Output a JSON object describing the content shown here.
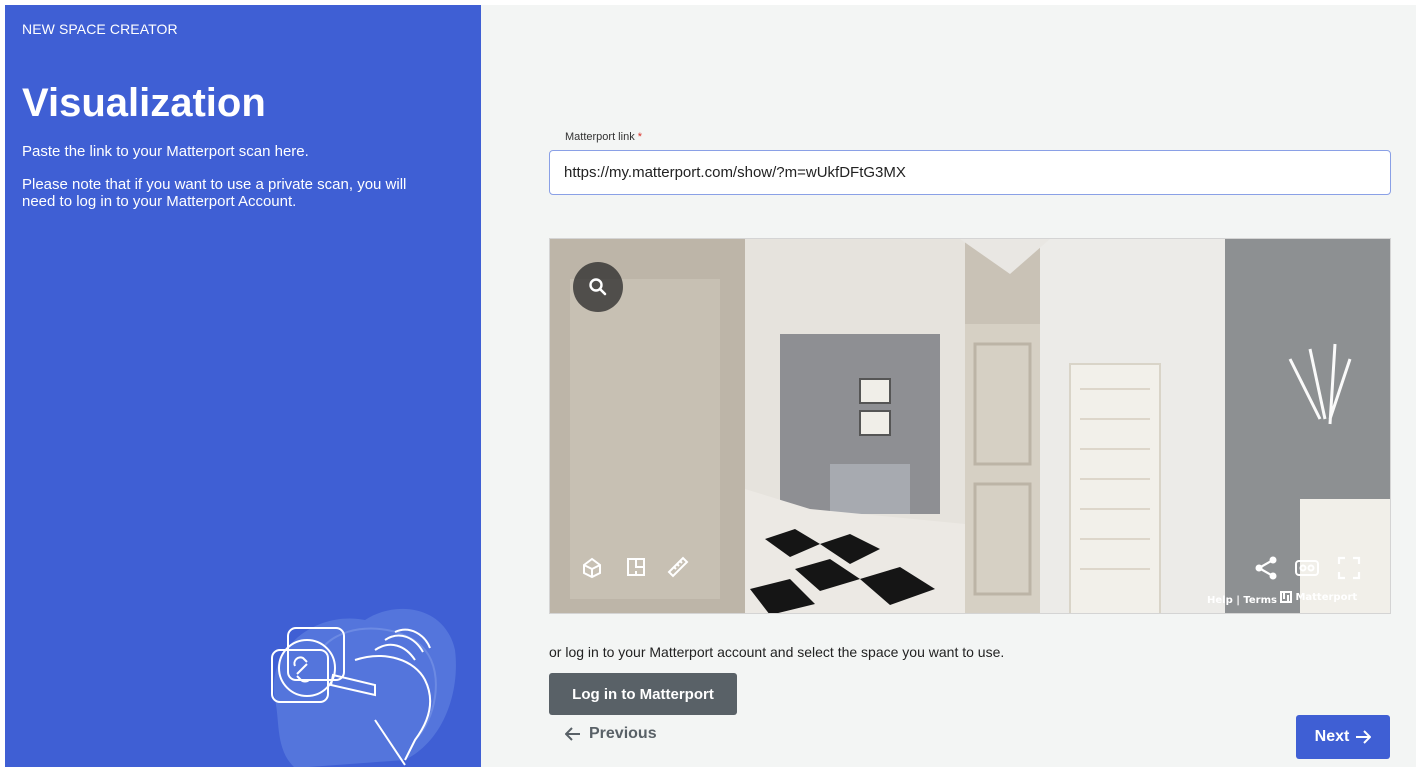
{
  "sidebar": {
    "eyebrow": "NEW SPACE CREATOR",
    "title": "Visualization",
    "description_1": "Paste the link to your Matterport scan here.",
    "description_2": "Please note that if you want to use a private scan, you will need to log in to your Matterport Account."
  },
  "form": {
    "field_label": "Matterport link",
    "required_mark": "*",
    "link_value": "https://my.matterport.com/show/?m=wUkfDFtG3MX"
  },
  "viewer": {
    "icons": [
      "search-icon",
      "dollhouse-icon",
      "floorplan-icon",
      "measure-icon",
      "share-icon",
      "vr-icon",
      "fullscreen-icon"
    ],
    "credit_help": "Help",
    "credit_separator": "|",
    "credit_terms": "Terms",
    "credit_brand": "Matterport"
  },
  "actions": {
    "or_text": "or log in to your Matterport account and select the space you want to use.",
    "login_label": "Log in to Matterport",
    "previous_label": "Previous",
    "next_label": "Next"
  },
  "colors": {
    "accent": "#3f5fd4",
    "secondary_button": "#596167",
    "panel_background": "#f3f5f4"
  }
}
